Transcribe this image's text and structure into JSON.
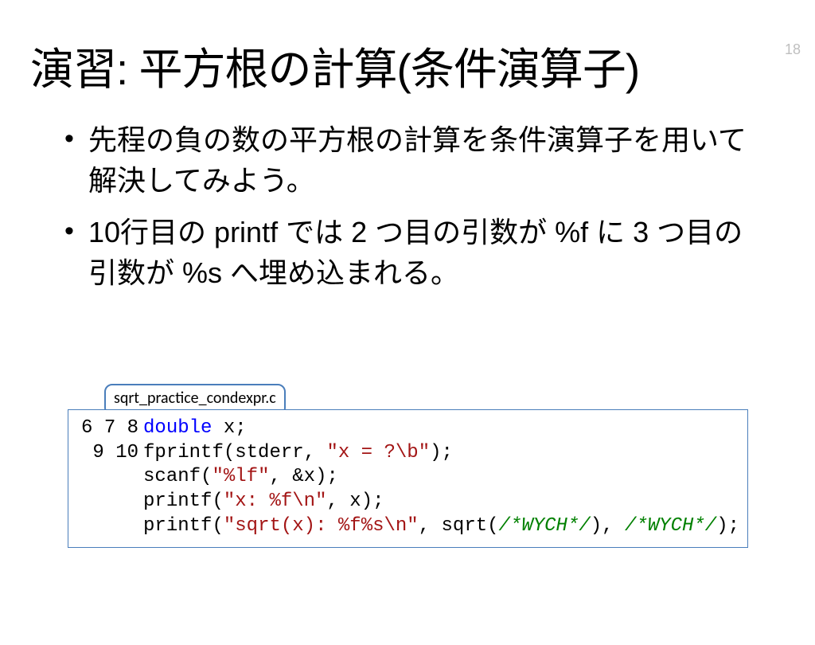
{
  "page_number": "18",
  "title": "演習: 平方根の計算(条件演算子)",
  "bullets": [
    "先程の負の数の平方根の計算を条件演算子を用いて解決してみよう。",
    "10行目の printf では 2 つ目の引数が %f に 3 つ目の引数が %s へ埋め込まれる。"
  ],
  "code_file": "sqrt_practice_condexpr.c",
  "code_start_line": 6,
  "code_tokens": [
    [
      [
        "double",
        "kw"
      ],
      [
        " x;",
        ""
      ]
    ],
    [
      [
        "fprintf(stderr, ",
        ""
      ],
      [
        "\"x = ?\\b\"",
        "str"
      ],
      [
        ");",
        ""
      ]
    ],
    [
      [
        "scanf(",
        ""
      ],
      [
        "\"%lf\"",
        "str"
      ],
      [
        ", &x);",
        ""
      ]
    ],
    [
      [
        "printf(",
        ""
      ],
      [
        "\"x: %f\\n\"",
        "str"
      ],
      [
        ", x);",
        ""
      ]
    ],
    [
      [
        "printf(",
        ""
      ],
      [
        "\"sqrt(x): %f%s\\n\"",
        "str"
      ],
      [
        ", sqrt(",
        ""
      ],
      [
        "/*WYCH*/",
        "cmt"
      ],
      [
        "), ",
        ""
      ],
      [
        "/*WYCH*/",
        "cmt"
      ],
      [
        ");",
        ""
      ]
    ]
  ]
}
